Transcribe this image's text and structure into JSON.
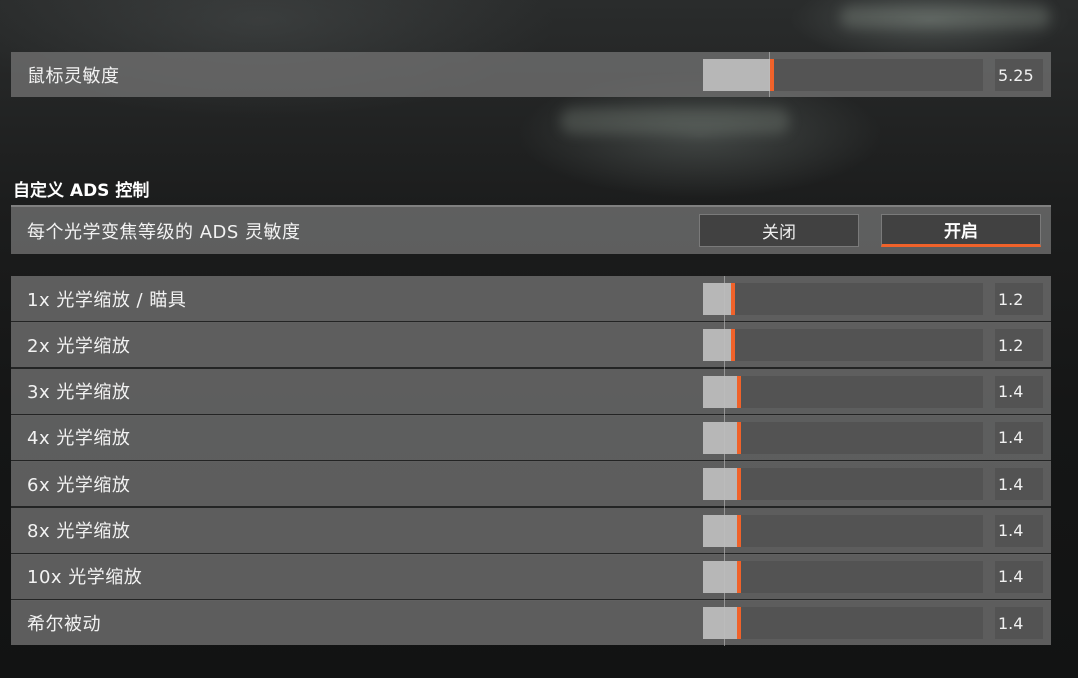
{
  "mouse": {
    "label": "鼠标灵敏度",
    "value": "5.25",
    "level": 0.24
  },
  "ads_section": {
    "title": "自定义 ADS 控制",
    "per_zoom_label": "每个光学变焦等级的 ADS 灵敏度",
    "off_label": "关闭",
    "on_label": "开启",
    "selected": "开启"
  },
  "zoom_rows": [
    {
      "label": "1x 光学缩放 / 瞄具",
      "value": "1.2",
      "level": 0.1
    },
    {
      "label": "2x 光学缩放",
      "value": "1.2",
      "level": 0.1
    },
    {
      "label": "3x 光学缩放",
      "value": "1.4",
      "level": 0.12
    },
    {
      "label": "4x 光学缩放",
      "value": "1.4",
      "level": 0.12
    },
    {
      "label": "6x 光学缩放",
      "value": "1.4",
      "level": 0.12
    },
    {
      "label": "8x 光学缩放",
      "value": "1.4",
      "level": 0.12
    },
    {
      "label": "10x 光学缩放",
      "value": "1.4",
      "level": 0.12
    },
    {
      "label": "希尔被动",
      "value": "1.4",
      "level": 0.12
    }
  ],
  "colors": {
    "accent": "#f0622a",
    "fill": "#b7b7b7",
    "row_bg": "#6e6e6e"
  }
}
